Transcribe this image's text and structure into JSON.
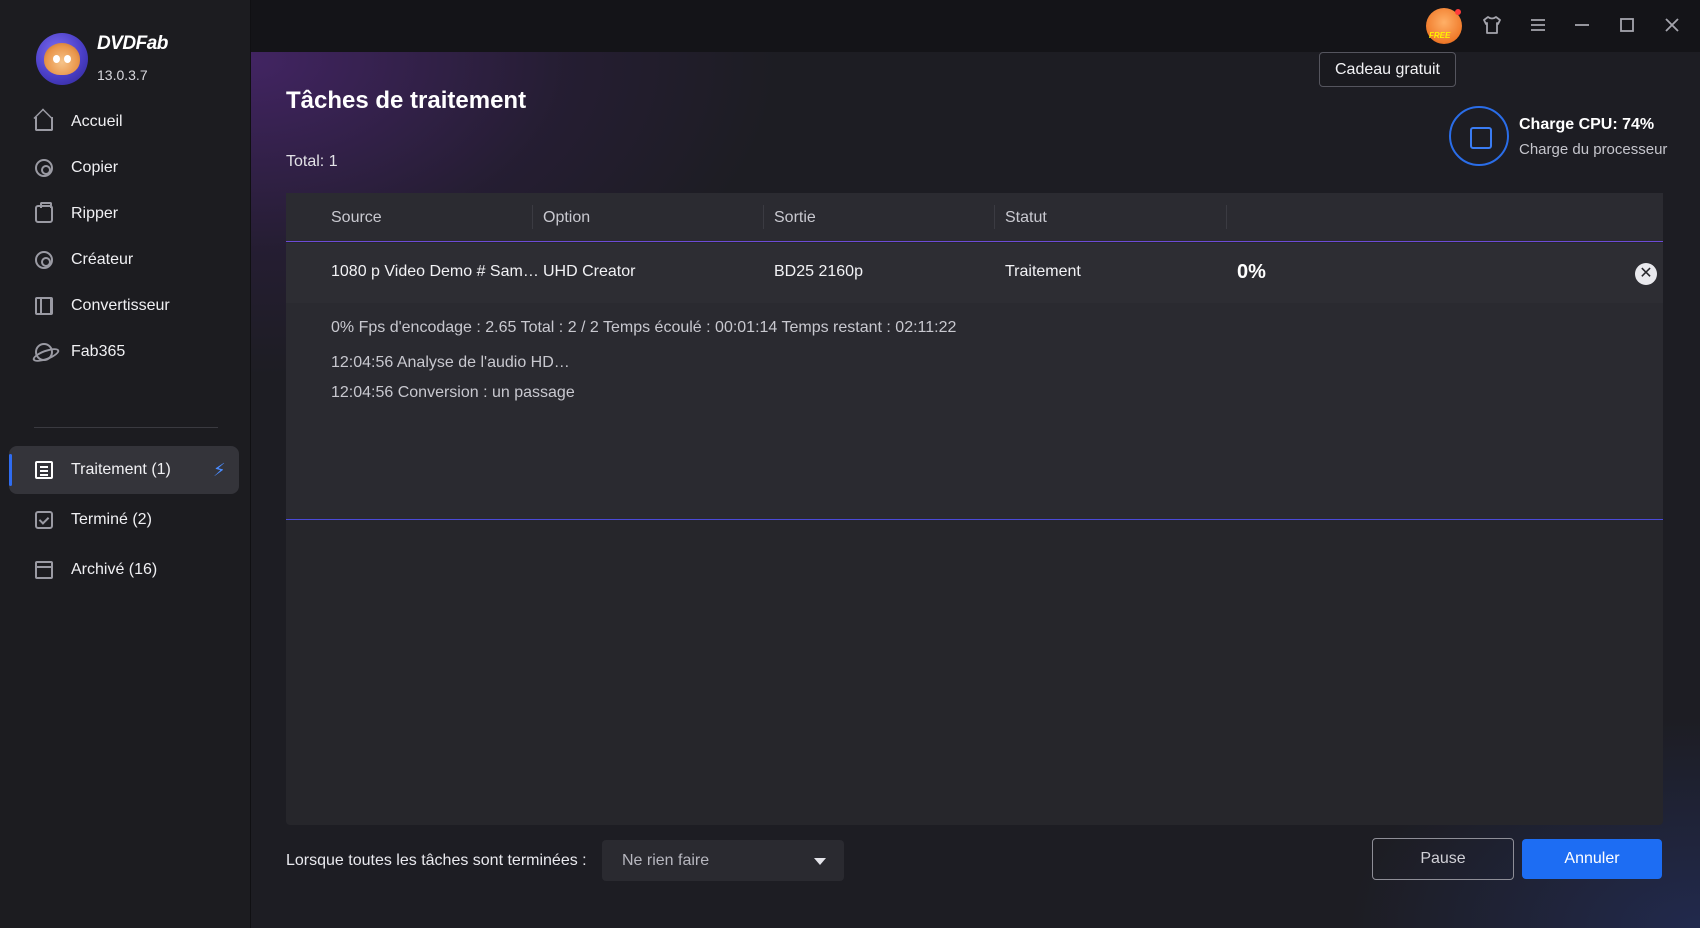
{
  "app": {
    "brand": "DVDFab",
    "version": "13.0.3.7"
  },
  "sidebar": {
    "items": [
      {
        "label": "Accueil",
        "icon": "home-icon"
      },
      {
        "label": "Copier",
        "icon": "disc-icon"
      },
      {
        "label": "Ripper",
        "icon": "ripper-icon"
      },
      {
        "label": "Créateur",
        "icon": "creator-icon"
      },
      {
        "label": "Convertisseur",
        "icon": "film-icon"
      },
      {
        "label": "Fab365",
        "icon": "planet-icon"
      }
    ],
    "queue": [
      {
        "label": "Traitement (1)",
        "icon": "list-icon",
        "active": true
      },
      {
        "label": "Terminé (2)",
        "icon": "check-icon"
      },
      {
        "label": "Archivé (16)",
        "icon": "archive-icon"
      }
    ]
  },
  "titlebar": {
    "free_badge": "FREE",
    "tooltip": "Cadeau gratuit"
  },
  "page": {
    "title": "Tâches de traitement",
    "total": "Total: 1"
  },
  "cpu": {
    "title": "Charge CPU: 74%",
    "subtitle": "Charge du processeur",
    "accent": "#2a6de8"
  },
  "table": {
    "headers": [
      "Source",
      "Option",
      "Sortie",
      "Statut"
    ],
    "row": {
      "source": "1080 p Video Demo # Sam…",
      "option": "UHD Creator",
      "output": "BD25 2160p",
      "status": "Traitement",
      "progress": "0%"
    },
    "details": {
      "stats": "0%   Fps d'encodage : 2.65    Total : 2 / 2   Temps écoulé : 00:01:14   Temps restant : 02:11:22",
      "log": [
        "12:04:56  Analyse de l'audio HD…",
        "12:04:56  Conversion : un passage"
      ]
    }
  },
  "footer": {
    "when_label": "Lorsque toutes les tâches sont terminées :",
    "select_value": "Ne rien faire",
    "pause": "Pause",
    "cancel": "Annuler",
    "accent": "#1d6df3"
  }
}
